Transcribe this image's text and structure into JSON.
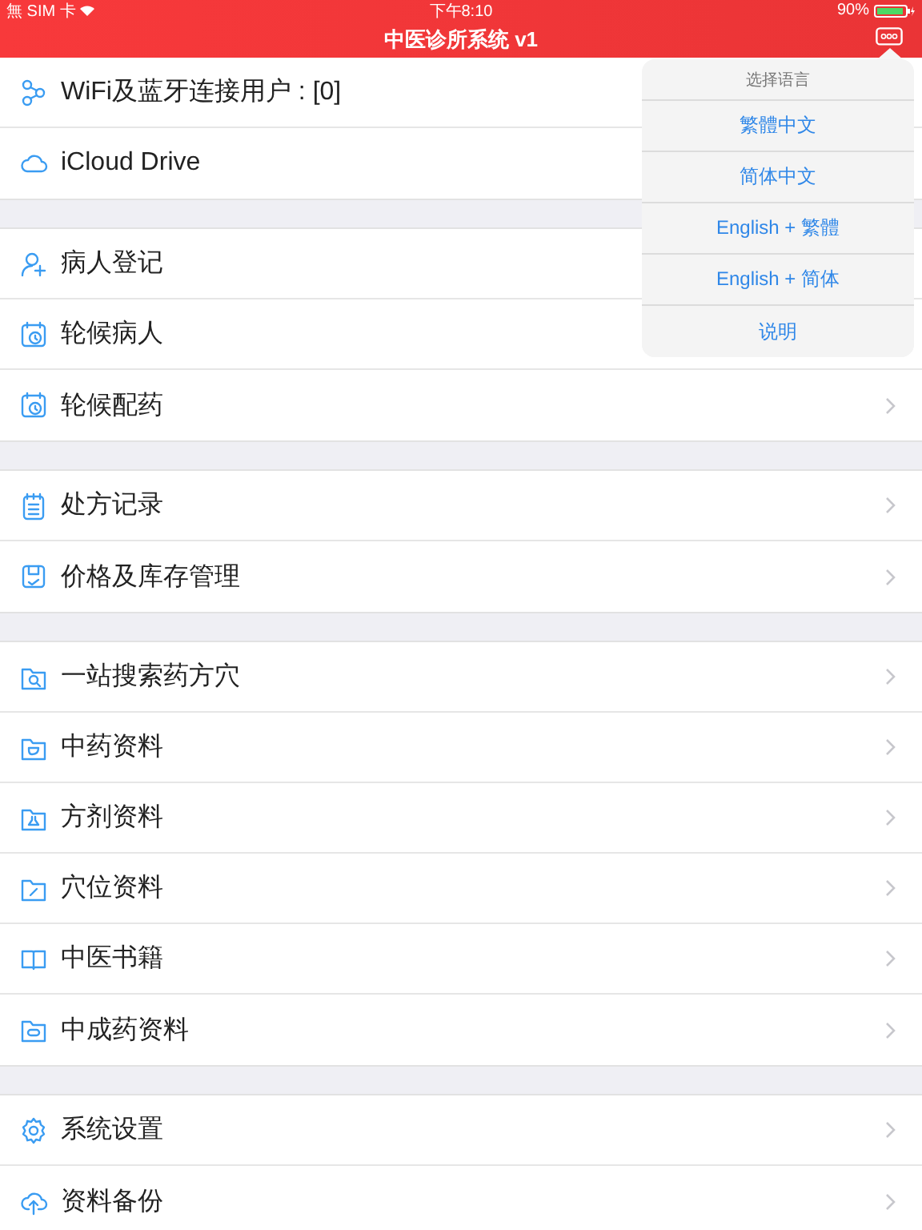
{
  "status_bar": {
    "carrier": "無 SIM 卡",
    "time": "下午8:10",
    "battery": "90%"
  },
  "nav_bar": {
    "title": "中医诊所系统 v1"
  },
  "sections": [
    {
      "items": [
        {
          "label": "WiFi及蓝牙连接用户 : [0]"
        },
        {
          "label": "iCloud Drive"
        }
      ]
    },
    {
      "items": [
        {
          "label": "病人登记"
        },
        {
          "label": "轮候病人"
        },
        {
          "label": "轮候配药"
        }
      ]
    },
    {
      "items": [
        {
          "label": "处方记录"
        },
        {
          "label": "价格及库存管理"
        }
      ]
    },
    {
      "items": [
        {
          "label": "一站搜索药方穴"
        },
        {
          "label": "中药资料"
        },
        {
          "label": "方剂资料"
        },
        {
          "label": "穴位资料"
        },
        {
          "label": "中医书籍"
        },
        {
          "label": "中成药资料"
        }
      ]
    },
    {
      "items": [
        {
          "label": "系统设置"
        },
        {
          "label": "资料备份"
        }
      ]
    }
  ],
  "popover": {
    "title": "选择语言",
    "options": [
      "繁體中文",
      "简体中文",
      "English + 繁體",
      "English + 简体",
      "说明"
    ]
  }
}
